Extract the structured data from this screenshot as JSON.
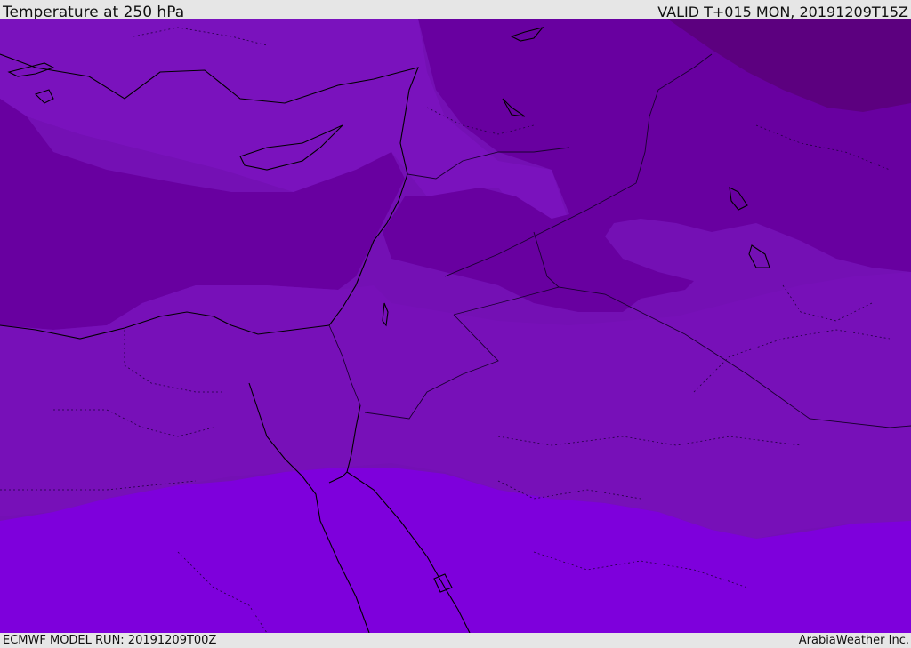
{
  "header": {
    "title": "Temperature at 250 hPa",
    "valid_time": "VALID T+015 MON, 20191209T15Z"
  },
  "footer": {
    "model_run": "ECMWF MODEL RUN: 20191209T00Z",
    "credit": "ArabiaWeather Inc."
  },
  "map": {
    "colors": {
      "band_darkest": "#5c007f",
      "band_dark": "#6800a0",
      "band_mid": "#7410b4",
      "band_light": "#7a10c0",
      "band_bright": "#7e00dc",
      "coastline": "#000000",
      "border": "#1a0030"
    }
  }
}
